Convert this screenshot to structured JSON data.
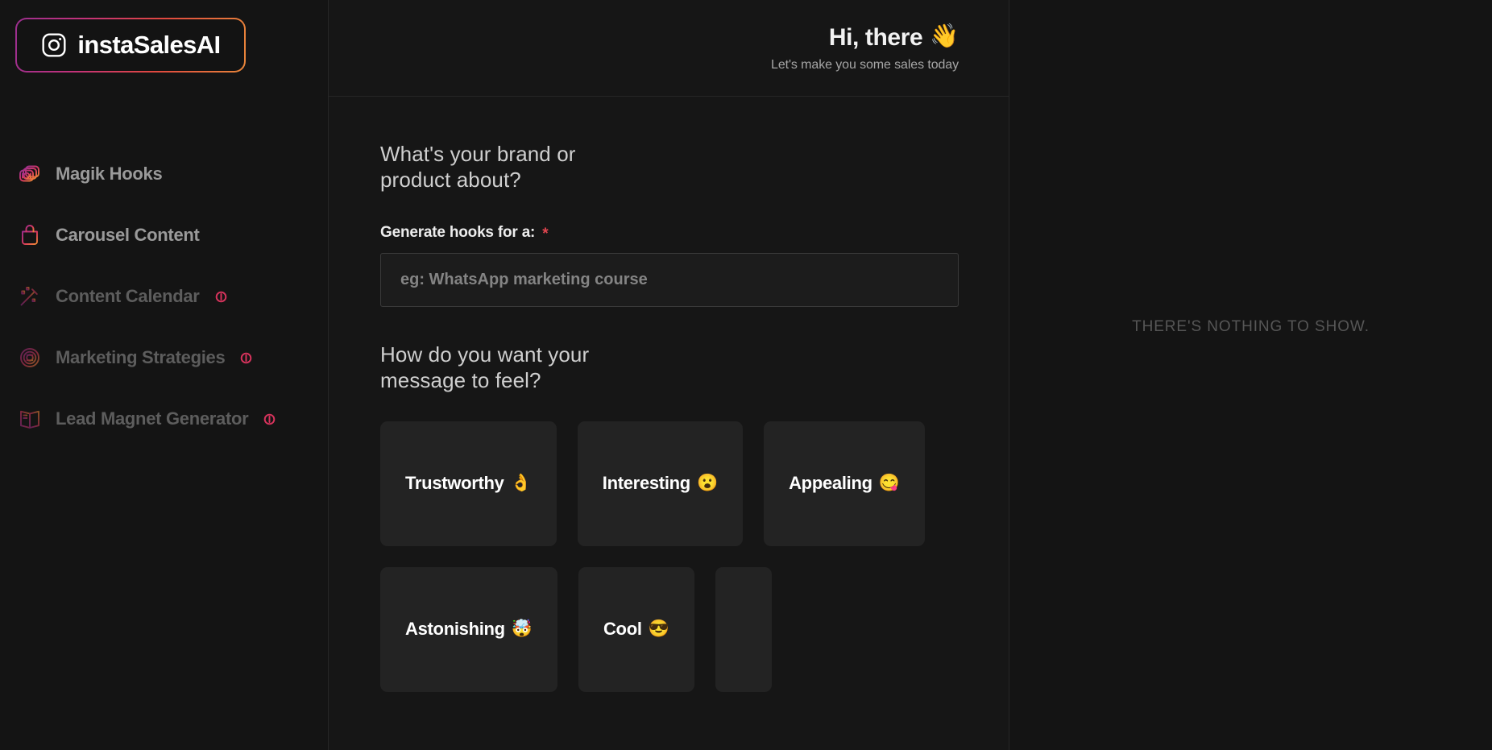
{
  "brand": {
    "name": "instaSalesAI",
    "icon": "instagram-camera-icon",
    "gradient_start": "#9b2f8f",
    "gradient_end": "#e8863a"
  },
  "sidebar": {
    "items": [
      {
        "label": "Magik Hooks",
        "icon": "stacked-images-icon",
        "locked": false
      },
      {
        "label": "Carousel Content",
        "icon": "bag-icon",
        "locked": false
      },
      {
        "label": "Content Calendar",
        "icon": "magic-wand-icon",
        "locked": true
      },
      {
        "label": "Marketing Strategies",
        "icon": "spiral-target-icon",
        "locked": true
      },
      {
        "label": "Lead Magnet Generator",
        "icon": "open-book-icon",
        "locked": true
      }
    ],
    "lock_badge_icon": "locked-info-badge-icon",
    "lock_badge_color": "#d6335c"
  },
  "header": {
    "greeting": "Hi, there",
    "greeting_emoji": "👋",
    "subtitle": "Let's make you some sales today"
  },
  "form": {
    "brand_question": "What's your brand or product about?",
    "generate_label": "Generate hooks for a:",
    "required_marker": "*",
    "required_color": "#e0454f",
    "input_value": "",
    "input_placeholder": "eg: WhatsApp marketing course",
    "tone_question": "How do you want your message to feel?",
    "tones": [
      {
        "label": "Trustworthy",
        "emoji": "👌"
      },
      {
        "label": "Interesting",
        "emoji": "😮"
      },
      {
        "label": "Appealing",
        "emoji": "😋"
      },
      {
        "label": "Astonishing",
        "emoji": "🤯"
      },
      {
        "label": "Cool",
        "emoji": "😎"
      },
      {
        "label": "",
        "emoji": ""
      }
    ]
  },
  "results": {
    "empty_message": "THERE'S NOTHING TO SHOW."
  }
}
